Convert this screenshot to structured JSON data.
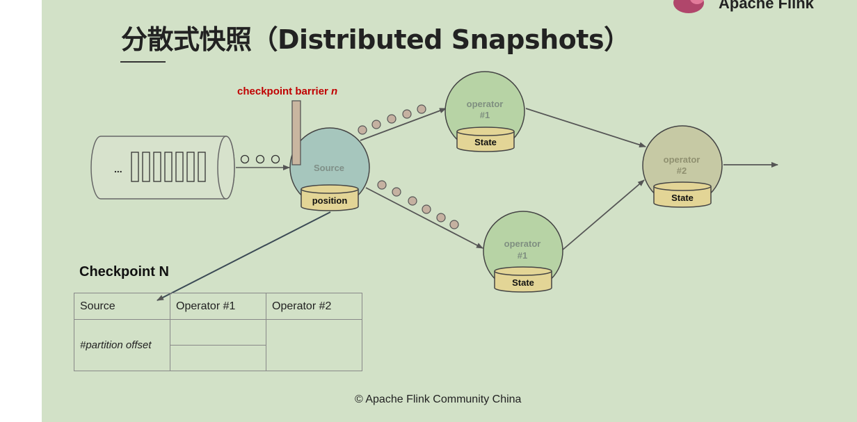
{
  "slide": {
    "title": "分散式快照（Distributed Snapshots）",
    "brand": "Apache Flink",
    "footer": "© Apache Flink Community China"
  },
  "diagram": {
    "barrier_label_prefix": "checkpoint barrier ",
    "barrier_label_n": "n",
    "queue_ellipsis": "...",
    "source": {
      "label": "Source",
      "store_label": "position"
    },
    "op_top": {
      "line1": "operator",
      "line2": "#1",
      "store_label": "State"
    },
    "op_bottom": {
      "line1": "operator",
      "line2": "#1",
      "store_label": "State"
    },
    "op_right": {
      "line1": "operator",
      "line2": "#2",
      "store_label": "State"
    }
  },
  "checkpoint": {
    "heading": "Checkpoint N",
    "headers": [
      "Source",
      "Operator #1",
      "Operator #2"
    ],
    "source_value": "#partition offset"
  },
  "colors": {
    "background": "#d2e1c7",
    "barrier_label": "#c00000",
    "source_fill": "#a6c6bd",
    "operator_fill": "#b7d3a5",
    "operator2_fill": "#c6c9a4",
    "store_fill": "#e3d596",
    "record_fill": "#c5b1a1"
  }
}
